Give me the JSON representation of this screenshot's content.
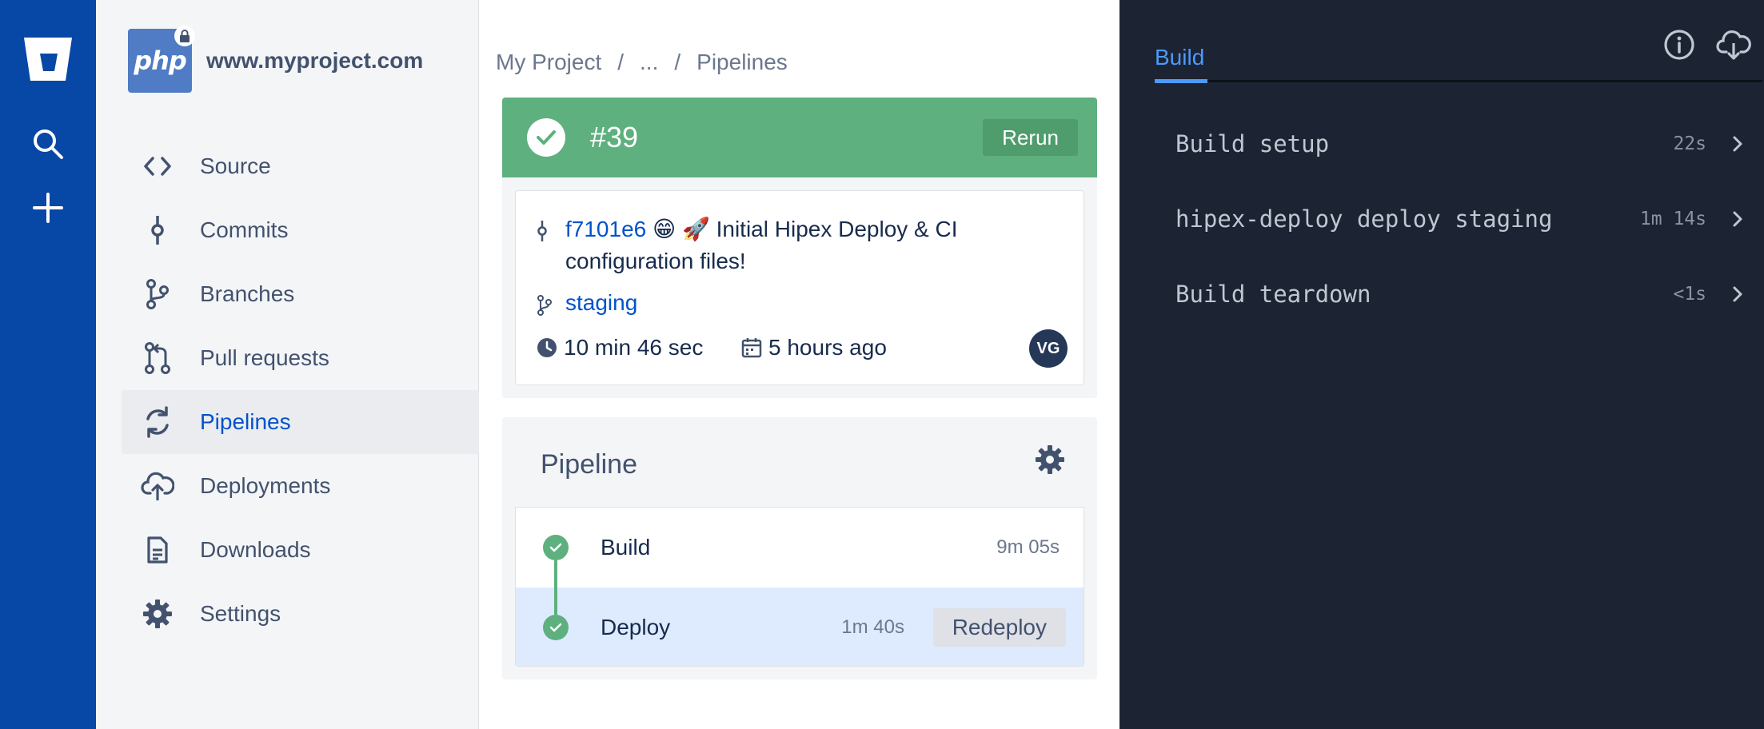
{
  "project": {
    "name": "www.myproject.com",
    "logo_text": "php"
  },
  "sidebar": {
    "items": [
      {
        "label": "Source",
        "icon": "code-icon"
      },
      {
        "label": "Commits",
        "icon": "commit-icon"
      },
      {
        "label": "Branches",
        "icon": "branch-icon"
      },
      {
        "label": "Pull requests",
        "icon": "pull-request-icon"
      },
      {
        "label": "Pipelines",
        "icon": "pipelines-icon",
        "active": true
      },
      {
        "label": "Deployments",
        "icon": "cloud-upload-icon"
      },
      {
        "label": "Downloads",
        "icon": "document-icon"
      },
      {
        "label": "Settings",
        "icon": "gear-icon"
      }
    ]
  },
  "breadcrumb": {
    "project": "My Project",
    "sep1": "/",
    "ellipsis": "...",
    "sep2": "/",
    "current": "Pipelines"
  },
  "run": {
    "status_color": "#5eb07f",
    "number": "#39",
    "rerun_label": "Rerun",
    "commit_hash": "f7101e6",
    "commit_message": "😁 🚀 Initial Hipex Deploy & CI configuration files!",
    "branch": "staging",
    "duration": "10 min 46 sec",
    "started": "5 hours ago",
    "author_initials": "VG"
  },
  "pipeline": {
    "title": "Pipeline",
    "steps": [
      {
        "name": "Build",
        "duration": "9m 05s"
      },
      {
        "name": "Deploy",
        "duration": "1m 40s",
        "action": "Redeploy"
      }
    ]
  },
  "build_panel": {
    "tab": "Build",
    "steps": [
      {
        "name": "Build setup",
        "duration": "22s"
      },
      {
        "name": "hipex-deploy deploy staging",
        "duration": "1m 14s"
      },
      {
        "name": "Build teardown",
        "duration": "<1s"
      }
    ]
  }
}
